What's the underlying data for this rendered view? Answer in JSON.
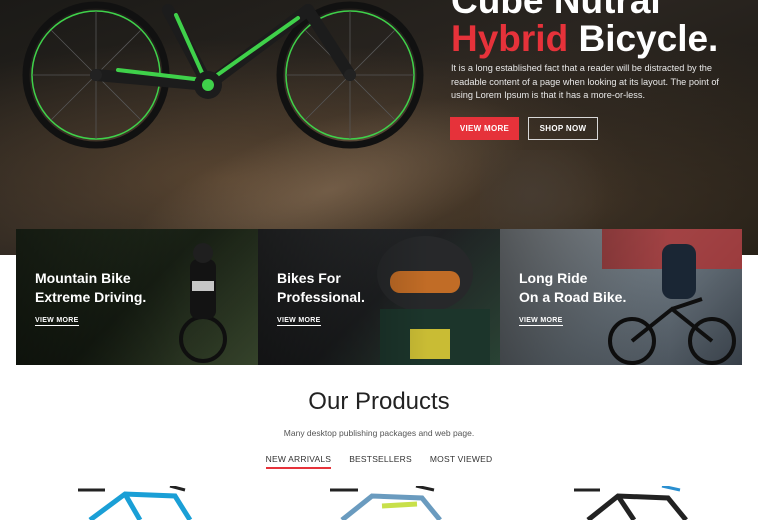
{
  "hero": {
    "title_line1": "Cube Nutral",
    "title_accent": "Hybrid",
    "title_rest": " Bicycle.",
    "description": "It is a long established fact that a reader will be distracted by the readable content of a page when looking at its layout. The point of using Lorem Ipsum is that it has a more-or-less.",
    "view_more_label": "VIEW MORE",
    "shop_now_label": "SHOP NOW"
  },
  "banners": [
    {
      "line1": "Mountain Bike",
      "line2": "Extreme Driving.",
      "link": "VIEW MORE"
    },
    {
      "line1": "Bikes For",
      "line2": "Professional.",
      "link": "VIEW MORE"
    },
    {
      "line1": "Long Ride",
      "line2": "On a Road Bike.",
      "link": "VIEW MORE"
    }
  ],
  "products_section": {
    "title": "Our Products",
    "subtitle": "Many desktop publishing packages and web page.",
    "tabs": [
      {
        "label": "NEW ARRIVALS",
        "active": true
      },
      {
        "label": "BESTSELLERS",
        "active": false
      },
      {
        "label": "MOST VIEWED",
        "active": false
      }
    ]
  },
  "colors": {
    "accent": "#e6323a",
    "bike_green": "#3fd14a"
  }
}
